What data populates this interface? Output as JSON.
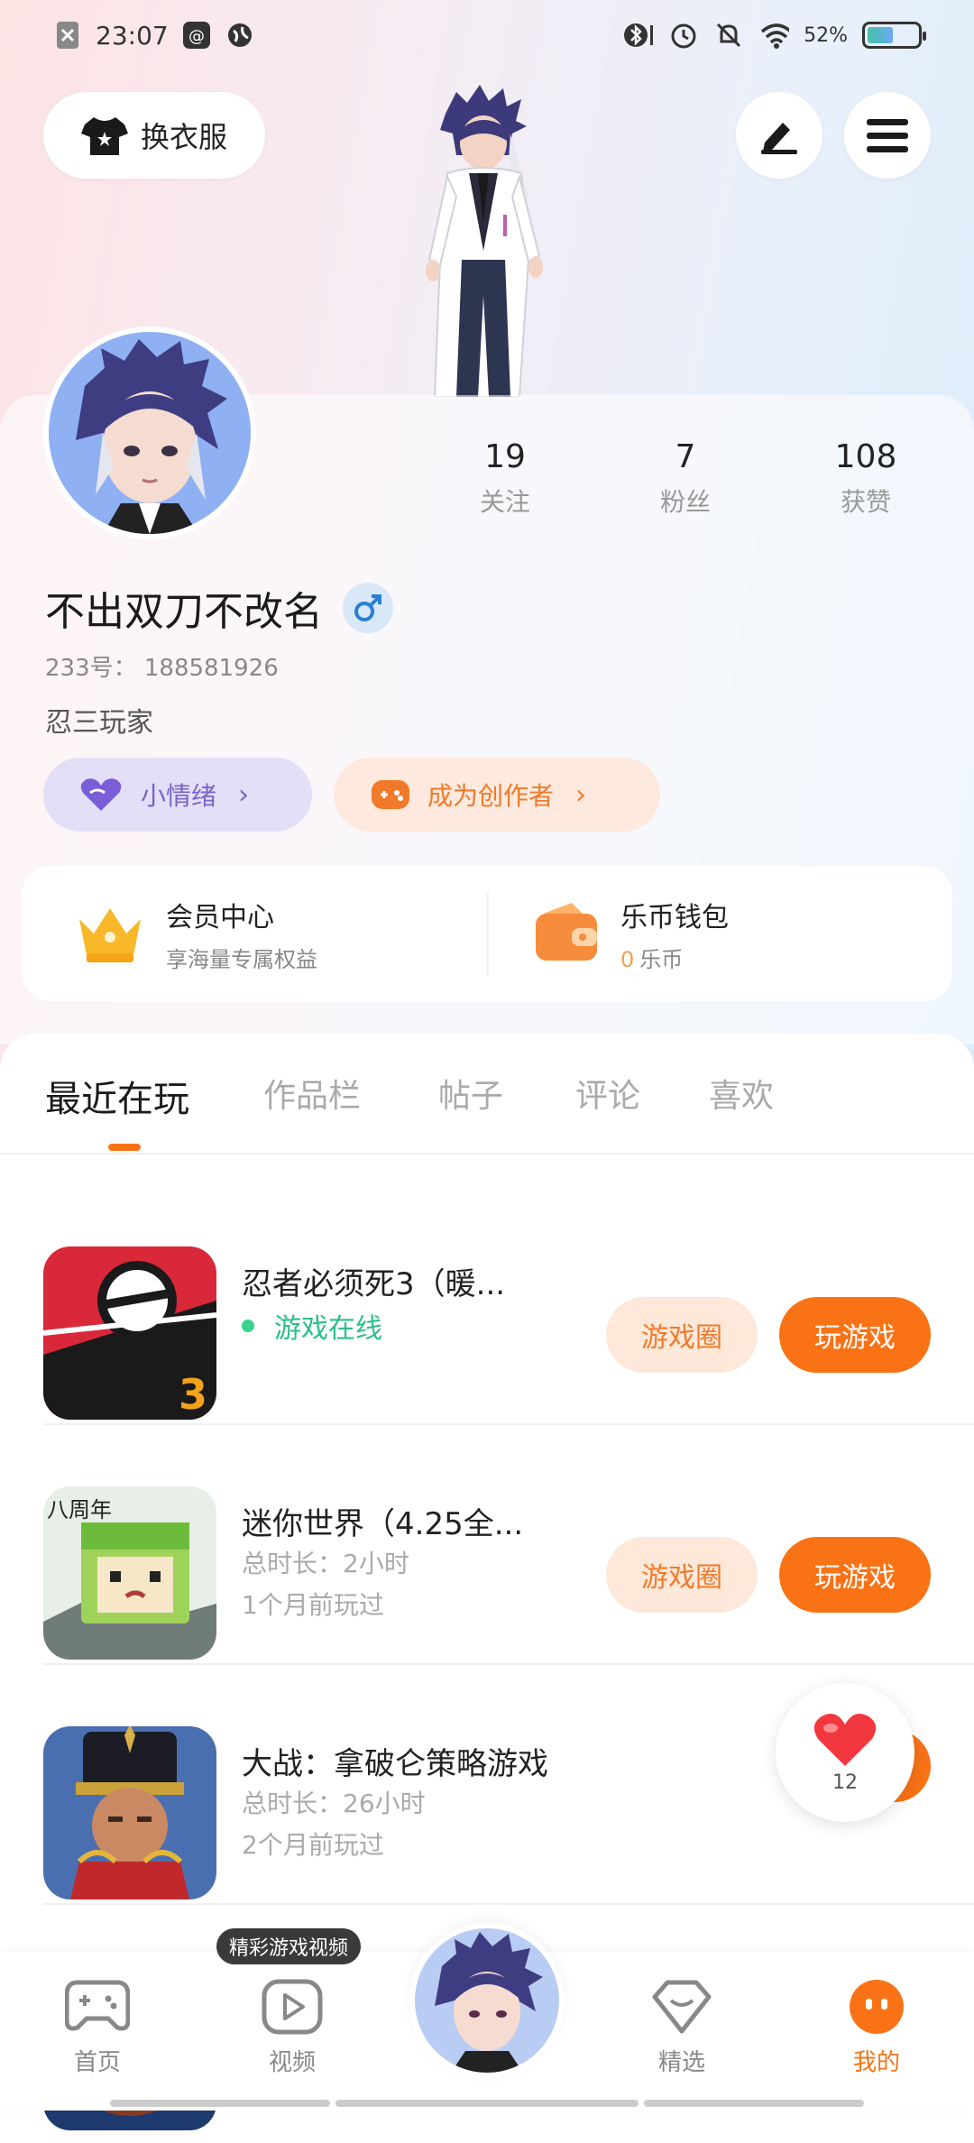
{
  "status_bar": {
    "time": "23:07",
    "battery": "52%",
    "battery_level": 0.52
  },
  "header": {
    "outfit_label": "换衣服"
  },
  "profile": {
    "username": "不出双刀不改名",
    "uid": "233号： 188581926",
    "bio": "忍三玩家",
    "stats": [
      {
        "value": "19",
        "label": "关注"
      },
      {
        "value": "7",
        "label": "粉丝"
      },
      {
        "value": "108",
        "label": "获赞"
      }
    ],
    "mood_label": "小情绪",
    "creator_label": "成为创作者"
  },
  "member": {
    "vip_title": "会员中心",
    "vip_sub": "享海量专属权益",
    "wallet_title": "乐币钱包",
    "wallet_amount": "0",
    "wallet_unit": "乐币"
  },
  "tabs": [
    "最近在玩",
    "作品栏",
    "帖子",
    "评论",
    "喜欢"
  ],
  "games": [
    {
      "title": "忍者必须死3（暖...",
      "status": "游戏在线"
    },
    {
      "title": "迷你世界（4.25全...",
      "duration": "总时长：2小时",
      "last_played": "1个月前玩过"
    },
    {
      "title": "大战：拿破仑策略游戏",
      "duration": "总时长：26小时",
      "last_played": "2个月前玩过"
    }
  ],
  "game_buttons": {
    "circle": "游戏圈",
    "play": "玩游戏"
  },
  "float_like": {
    "count": "12"
  },
  "tooltip": "精彩游戏视频",
  "nav": [
    {
      "label": "首页",
      "icon": "gamepad-icon"
    },
    {
      "label": "视频",
      "icon": "play-icon"
    },
    {
      "label": "精选",
      "icon": "heart-box-icon"
    },
    {
      "label": "我的",
      "icon": "smile-face-icon"
    }
  ],
  "colors": {
    "accent": "#f97316",
    "online": "#2bbf88",
    "mood": "#7a63c9"
  }
}
